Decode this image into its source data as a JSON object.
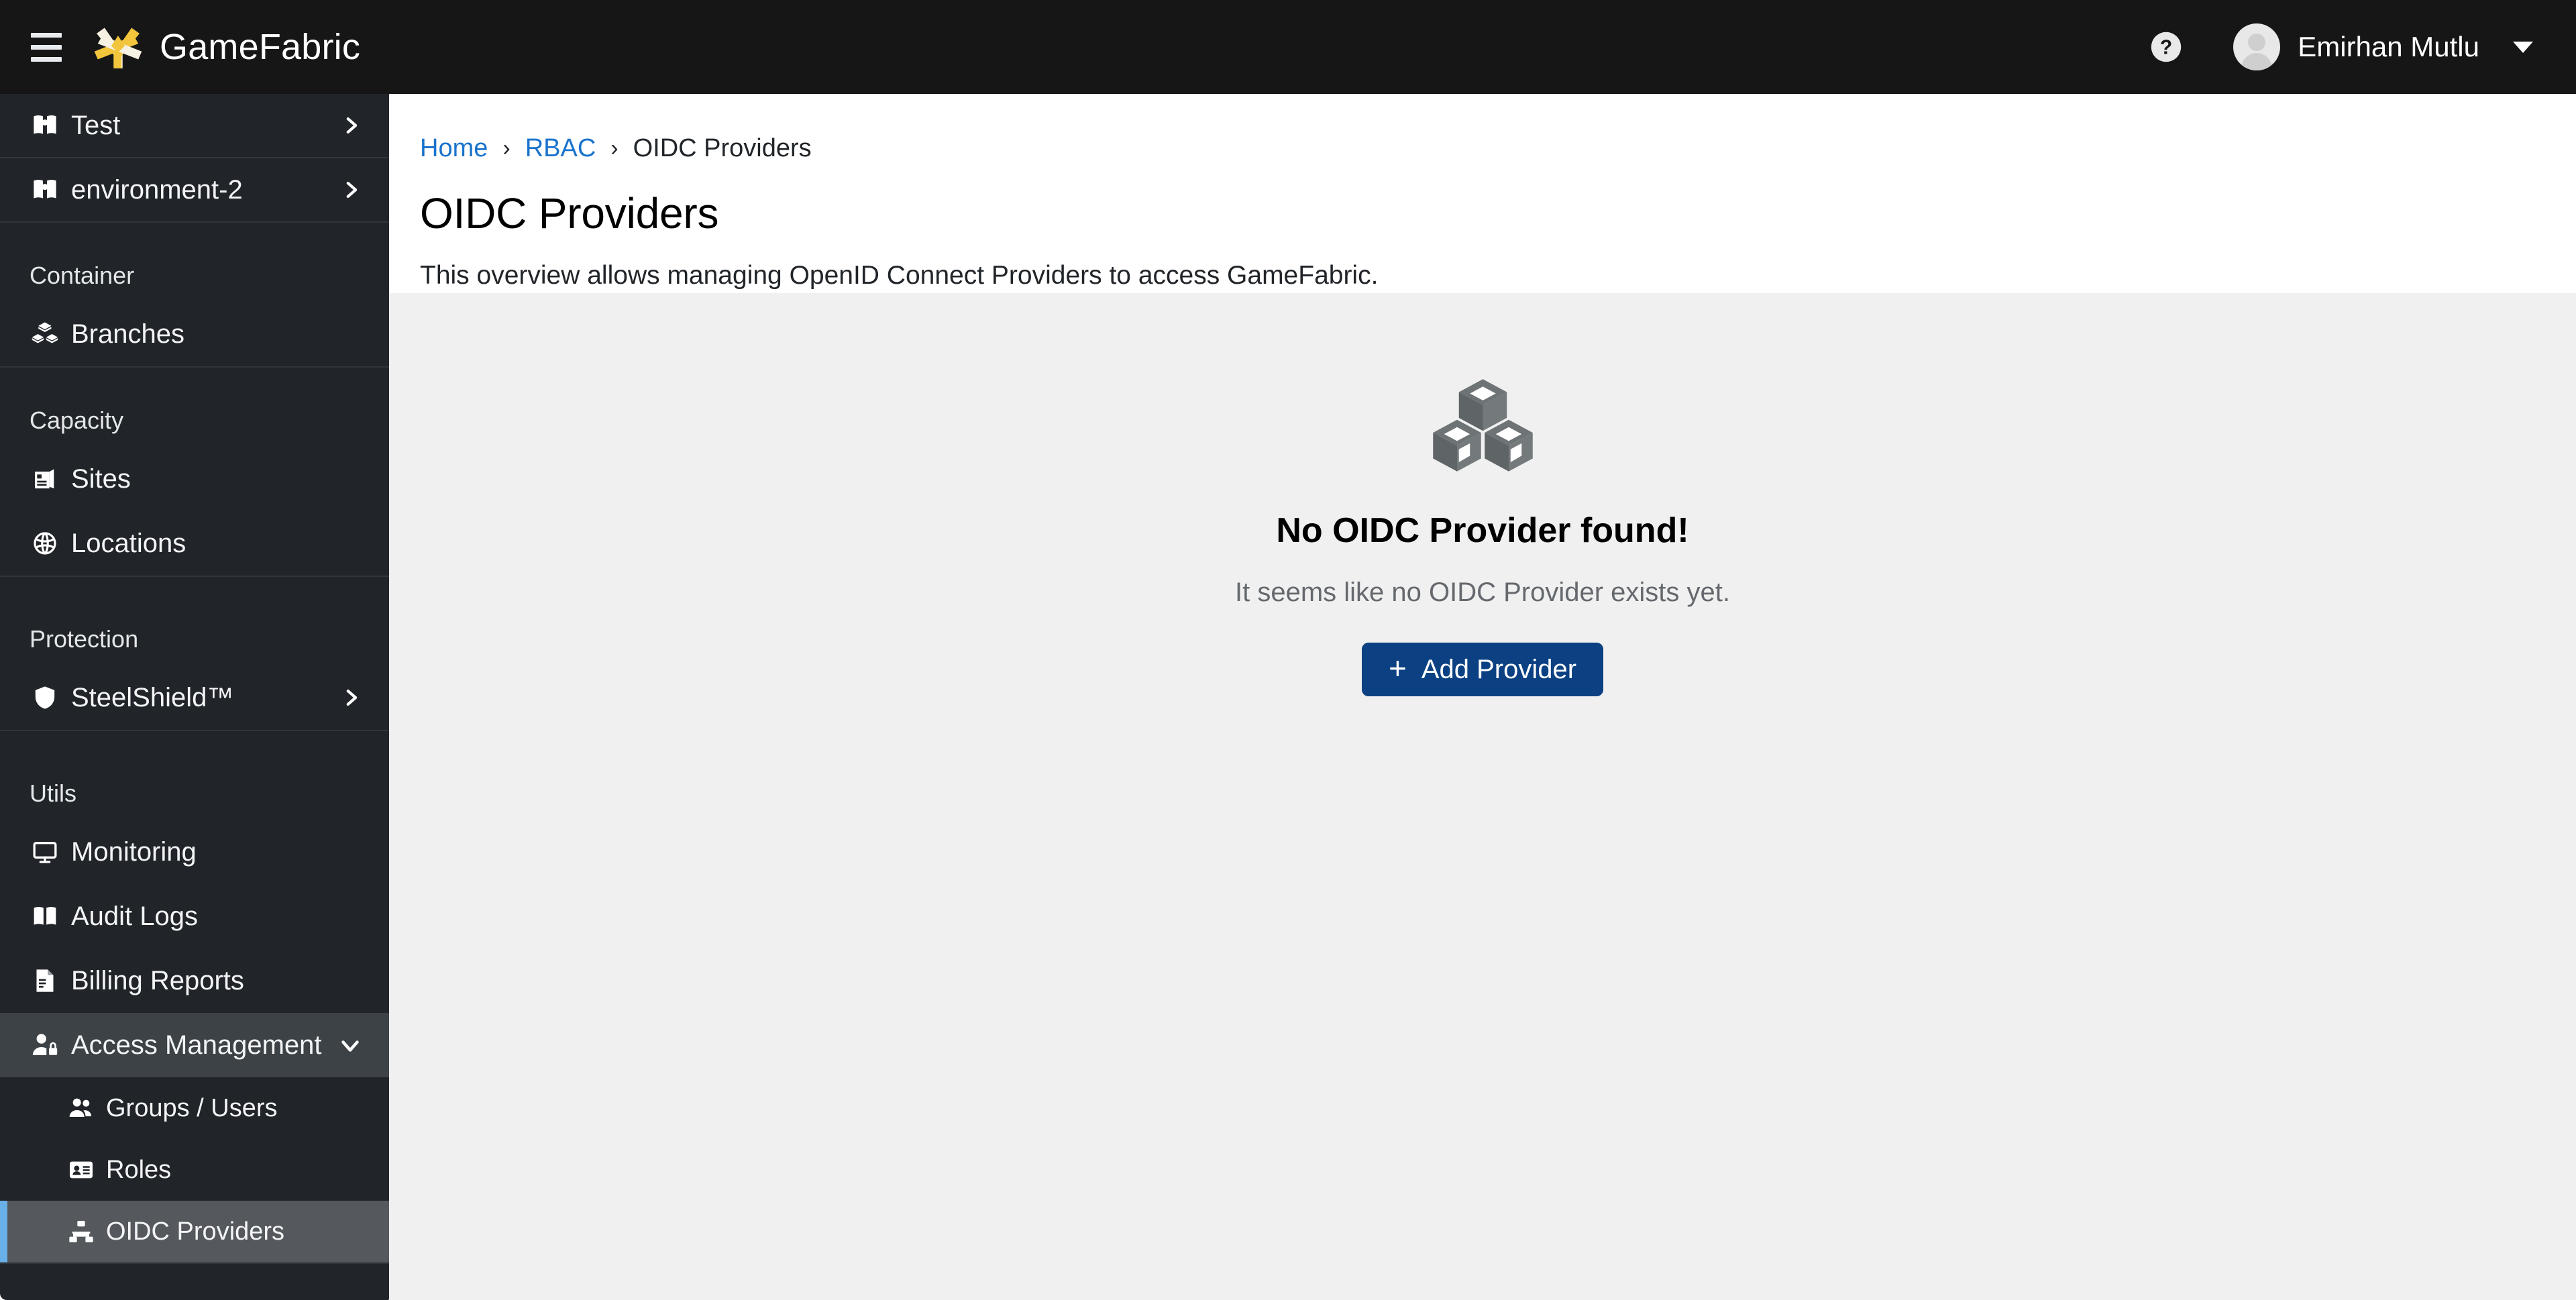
{
  "topbar": {
    "menu_icon": "hamburger-menu-icon",
    "brand": "GameFabric",
    "logo_icon": "gamefabric-logo-icon",
    "help_icon": "help-circle-icon",
    "user_name": "Emirhan Mutlu",
    "avatar_icon": "user-avatar-icon",
    "caret_icon": "caret-down-icon"
  },
  "sidebar": {
    "environments": [
      {
        "label": "Test",
        "icon": "atlas-book-icon",
        "chevron": "chevron-right-icon"
      },
      {
        "label": "environment-2",
        "icon": "atlas-book-icon",
        "chevron": "chevron-right-icon"
      }
    ],
    "sections": [
      {
        "title": "Container",
        "items": [
          {
            "label": "Branches",
            "icon": "stacked-cubes-icon"
          }
        ]
      },
      {
        "title": "Capacity",
        "items": [
          {
            "label": "Sites",
            "icon": "building-icon"
          },
          {
            "label": "Locations",
            "icon": "globe-icon"
          }
        ]
      },
      {
        "title": "Protection",
        "items": [
          {
            "label": "SteelShield™",
            "icon": "shield-icon",
            "chevron": "chevron-right-icon"
          }
        ]
      },
      {
        "title": "Utils",
        "items": [
          {
            "label": "Monitoring",
            "icon": "monitor-icon"
          },
          {
            "label": "Audit Logs",
            "icon": "open-book-icon"
          },
          {
            "label": "Billing Reports",
            "icon": "invoice-document-icon"
          },
          {
            "label": "Access Management",
            "icon": "user-lock-icon",
            "chevron": "chevron-down-icon",
            "expanded": true
          }
        ]
      }
    ],
    "access_management_children": [
      {
        "label": "Groups / Users",
        "icon": "users-group-icon",
        "selected": false
      },
      {
        "label": "Roles",
        "icon": "id-card-icon",
        "selected": false
      },
      {
        "label": "OIDC Providers",
        "icon": "sitemap-icon",
        "selected": true
      }
    ]
  },
  "content": {
    "breadcrumb": [
      {
        "label": "Home",
        "link": true
      },
      {
        "label": "RBAC",
        "link": true
      },
      {
        "label": "OIDC Providers",
        "link": false
      }
    ],
    "breadcrumb_separator": "›",
    "title": "OIDC Providers",
    "description": "This overview allows managing OpenID Connect Providers to access GameFabric.",
    "empty_state": {
      "icon": "cubes-empty-icon",
      "title": "No OIDC Provider found!",
      "subtitle": "It seems like no OIDC Provider exists yet.",
      "button_label": "Add Provider",
      "button_plus": "+"
    }
  },
  "colors": {
    "topbar_bg": "#161616",
    "sidebar_bg": "#212529",
    "sidebar_selected": "#55595d",
    "sidebar_active_parent": "#3d4246",
    "selected_accent": "#6ab0e8",
    "content_bg": "#f0f0f0",
    "link_blue": "#1a73cc",
    "primary_button": "#0b4182",
    "logo_yellow": "#f2c53d",
    "logo_cream": "#f6f1e2"
  }
}
